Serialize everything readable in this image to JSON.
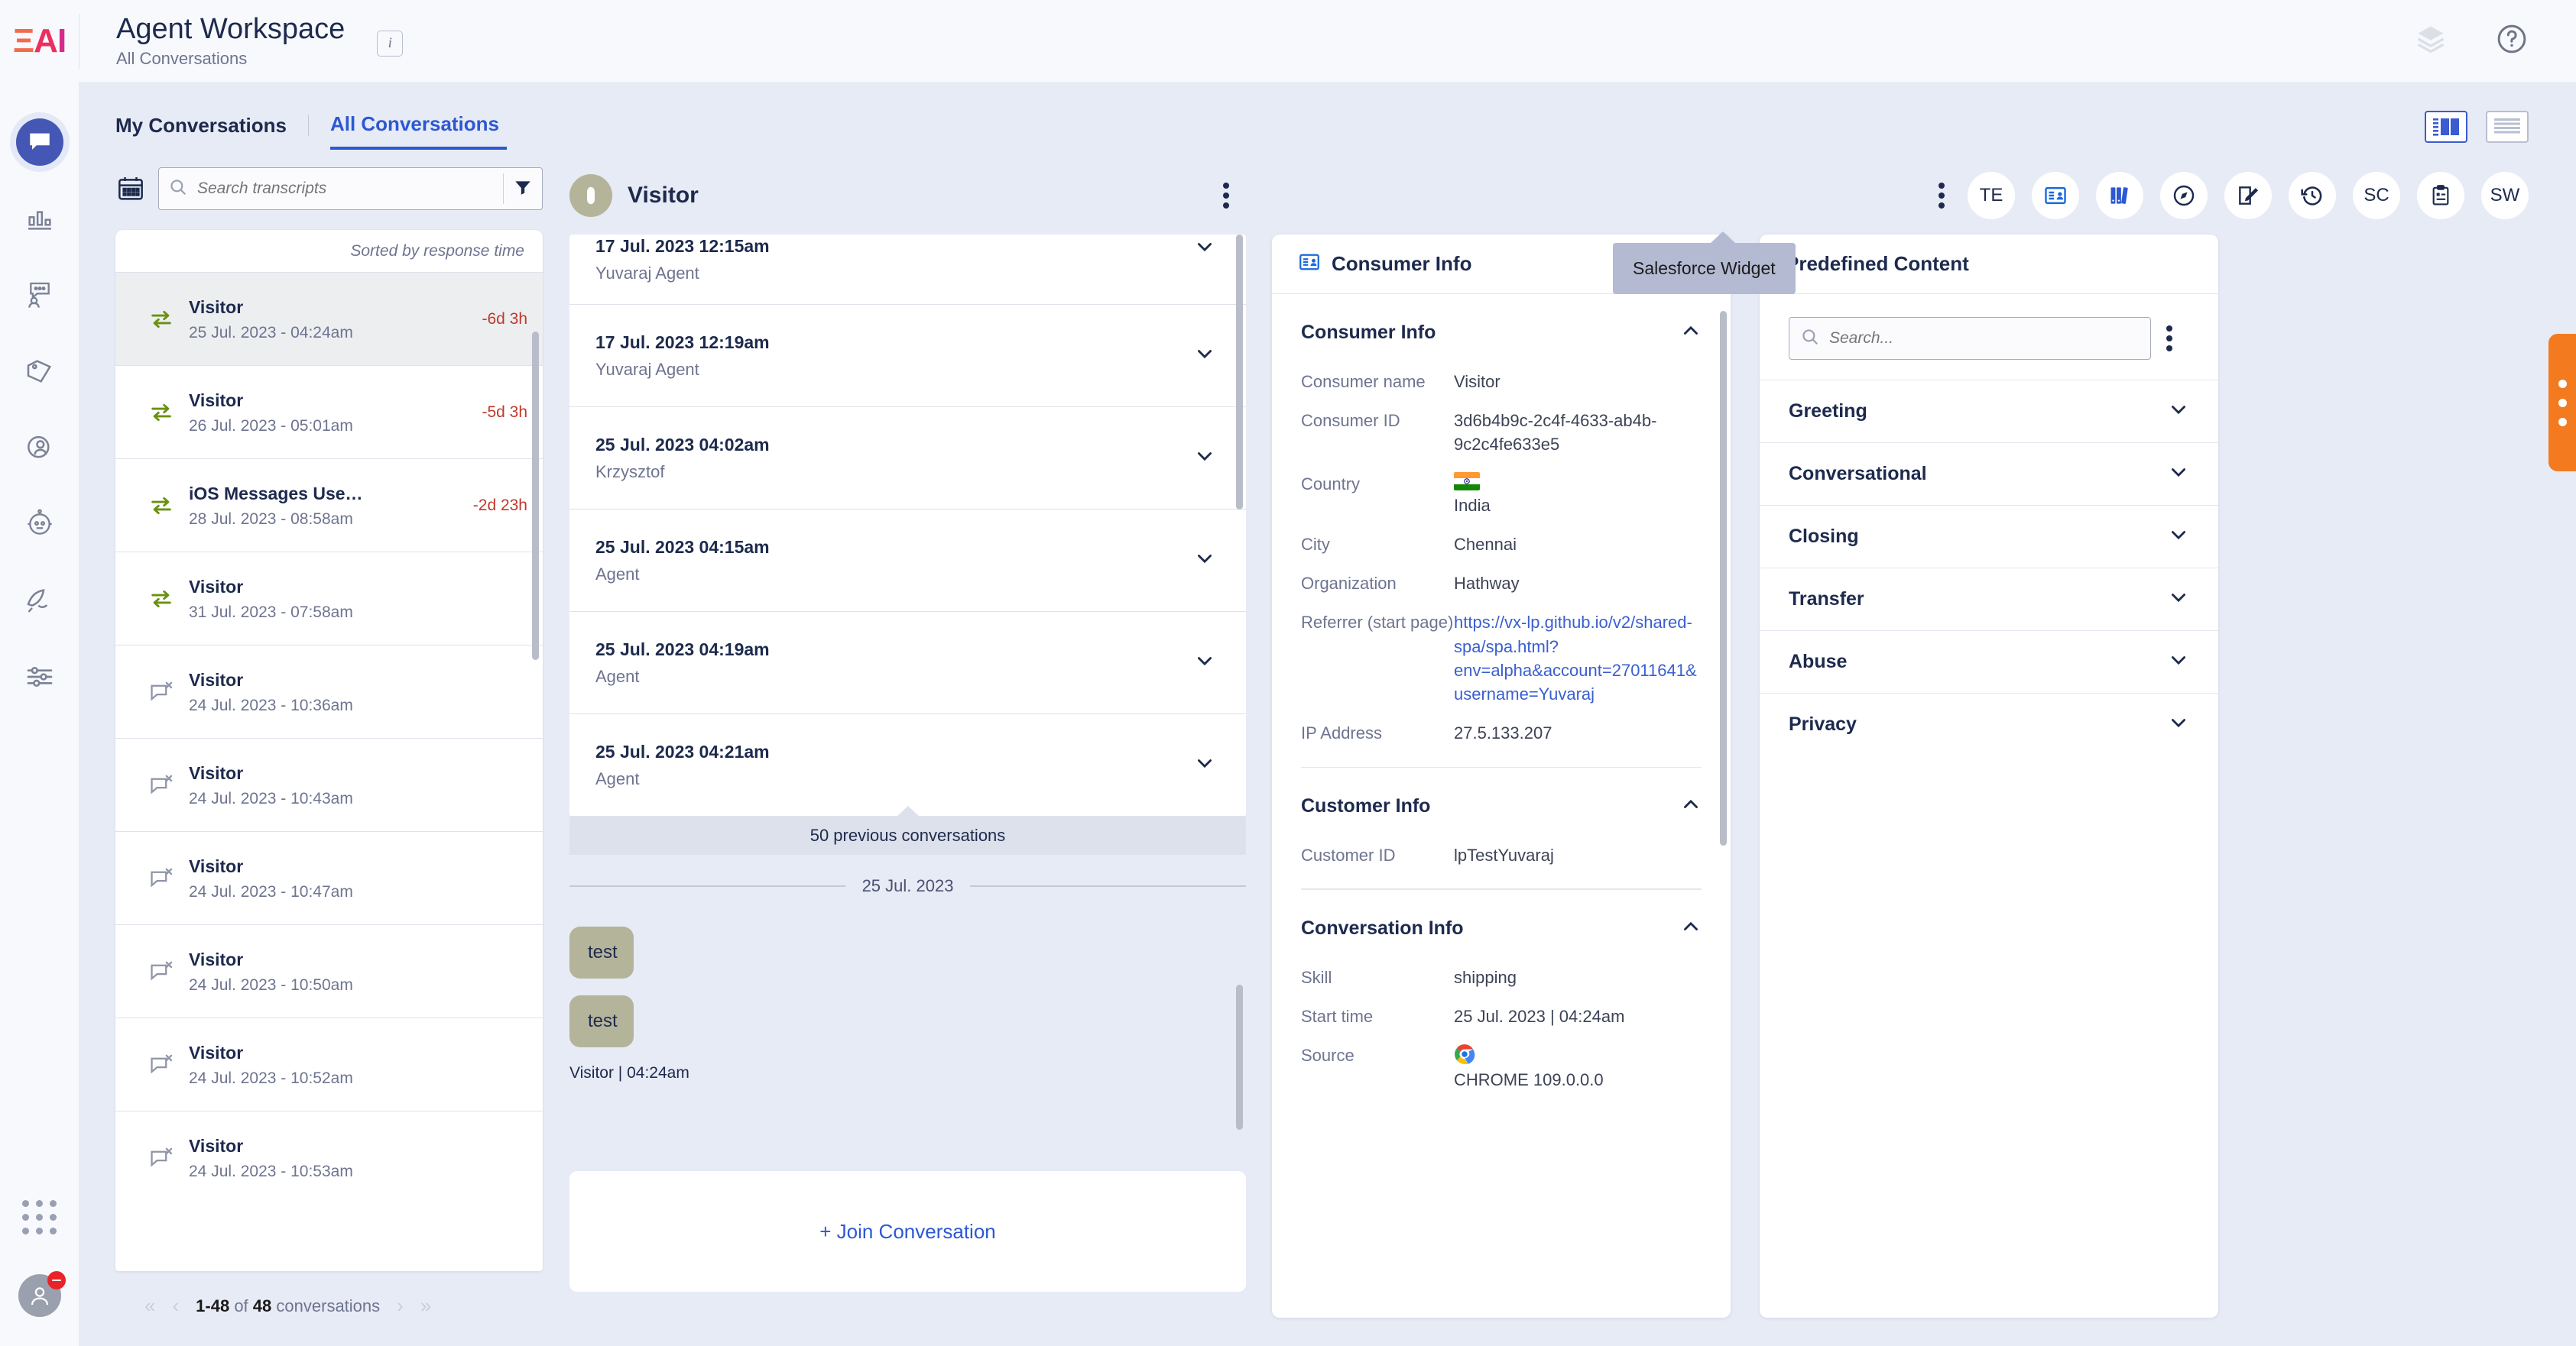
{
  "brand": {
    "logo_text": "EAI",
    "accent": "#2c58d4",
    "orange": "#f47a20"
  },
  "header": {
    "title": "Agent Workspace",
    "subtitle": "All Conversations",
    "info_badge": "i"
  },
  "tabs": [
    {
      "label": "My Conversations",
      "active": false
    },
    {
      "label": "All Conversations",
      "active": true
    }
  ],
  "conversation_list": {
    "search_placeholder": "Search transcripts",
    "sorted_by": "Sorted by response time",
    "rows": [
      {
        "icon": "transfer-icon",
        "name": "Visitor",
        "date": "25 Jul. 2023 - 04:24am",
        "due": "-6d 3h",
        "selected": true
      },
      {
        "icon": "transfer-icon",
        "name": "Visitor",
        "date": "26 Jul. 2023 - 05:01am",
        "due": "-5d 3h",
        "selected": false
      },
      {
        "icon": "transfer-icon",
        "name": "iOS Messages Use…",
        "date": "28 Jul. 2023 - 08:58am",
        "due": "-2d 23h",
        "selected": false
      },
      {
        "icon": "transfer-icon",
        "name": "Visitor",
        "date": "31 Jul. 2023 - 07:58am",
        "due": "",
        "selected": false
      },
      {
        "icon": "closed-chat-icon",
        "name": "Visitor",
        "date": "24 Jul. 2023 - 10:36am",
        "due": "",
        "selected": false
      },
      {
        "icon": "closed-chat-icon",
        "name": "Visitor",
        "date": "24 Jul. 2023 - 10:43am",
        "due": "",
        "selected": false
      },
      {
        "icon": "closed-chat-icon",
        "name": "Visitor",
        "date": "24 Jul. 2023 - 10:47am",
        "due": "",
        "selected": false
      },
      {
        "icon": "closed-chat-icon",
        "name": "Visitor",
        "date": "24 Jul. 2023 - 10:50am",
        "due": "",
        "selected": false
      },
      {
        "icon": "closed-chat-icon",
        "name": "Visitor",
        "date": "24 Jul. 2023 - 10:52am",
        "due": "",
        "selected": false
      },
      {
        "icon": "closed-chat-icon",
        "name": "Visitor",
        "date": "24 Jul. 2023 - 10:53am",
        "due": "",
        "selected": false
      }
    ],
    "pagination": {
      "range": "1-48",
      "of": "of",
      "total": "48",
      "unit": "conversations"
    }
  },
  "transcript": {
    "visitor_name": "Visitor",
    "previous": [
      {
        "date": "17 Jul. 2023 12:15am",
        "who": "Yuvaraj Agent"
      },
      {
        "date": "17 Jul. 2023 12:19am",
        "who": "Yuvaraj Agent"
      },
      {
        "date": "25 Jul. 2023 04:02am",
        "who": "Krzysztof"
      },
      {
        "date": "25 Jul. 2023 04:15am",
        "who": "Agent"
      },
      {
        "date": "25 Jul. 2023 04:19am",
        "who": "Agent"
      },
      {
        "date": "25 Jul. 2023 04:21am",
        "who": "Agent"
      }
    ],
    "previous_banner": "50 previous conversations",
    "day_divider": "25 Jul. 2023",
    "messages": [
      {
        "text": "test",
        "meta": ""
      },
      {
        "text": "test",
        "meta": "Visitor  |  04:24am"
      }
    ],
    "join_label": "+ Join Conversation"
  },
  "widget_toolbar": [
    {
      "label": "TE",
      "type": "text"
    },
    {
      "label": "",
      "type": "consumer-card-icon"
    },
    {
      "label": "",
      "type": "books-icon"
    },
    {
      "label": "",
      "type": "compass-icon"
    },
    {
      "label": "",
      "type": "edit-note-icon"
    },
    {
      "label": "",
      "type": "history-icon"
    },
    {
      "label": "SC",
      "type": "text"
    },
    {
      "label": "",
      "type": "clipboard-icon"
    },
    {
      "label": "SW",
      "type": "text"
    }
  ],
  "tooltip": {
    "text": "Salesforce Widget"
  },
  "consumer_panel": {
    "header": "Consumer Info",
    "sections": [
      {
        "title": "Consumer Info",
        "expanded": true,
        "fields": [
          {
            "key": "Consumer name",
            "value": "Visitor",
            "link": false
          },
          {
            "key": "Consumer ID",
            "value": "3d6b4b9c-2c4f-4633-ab4b-9c2c4fe633e5",
            "link": false
          },
          {
            "key": "Country",
            "value": "India",
            "link": false,
            "flag": "india-flag-icon"
          },
          {
            "key": "City",
            "value": "Chennai",
            "link": false
          },
          {
            "key": "Organization",
            "value": "Hathway",
            "link": false
          },
          {
            "key": "Referrer (start page)",
            "value": "https://vx-lp.github.io/v2/shared-spa/spa.html?env=alpha&account=27011641&username=Yuvaraj",
            "link": true
          },
          {
            "key": "IP Address",
            "value": "27.5.133.207",
            "link": false
          }
        ]
      },
      {
        "title": "Customer Info",
        "expanded": true,
        "fields": [
          {
            "key": "Customer ID",
            "value": "lpTestYuvaraj",
            "link": false
          }
        ]
      },
      {
        "title": "Conversation Info",
        "expanded": true,
        "fields": [
          {
            "key": "Skill",
            "value": "shipping",
            "link": false
          },
          {
            "key": "Start time",
            "value": "25 Jul. 2023 | 04:24am",
            "link": false
          },
          {
            "key": "Source",
            "value": "CHROME 109.0.0.0",
            "link": false,
            "browser": "chrome-icon"
          }
        ]
      }
    ]
  },
  "predefined_panel": {
    "header": "Predefined Content",
    "search_placeholder": "Search...",
    "categories": [
      {
        "label": "Greeting"
      },
      {
        "label": "Conversational"
      },
      {
        "label": "Closing"
      },
      {
        "label": "Transfer"
      },
      {
        "label": "Abuse"
      },
      {
        "label": "Privacy"
      }
    ]
  }
}
